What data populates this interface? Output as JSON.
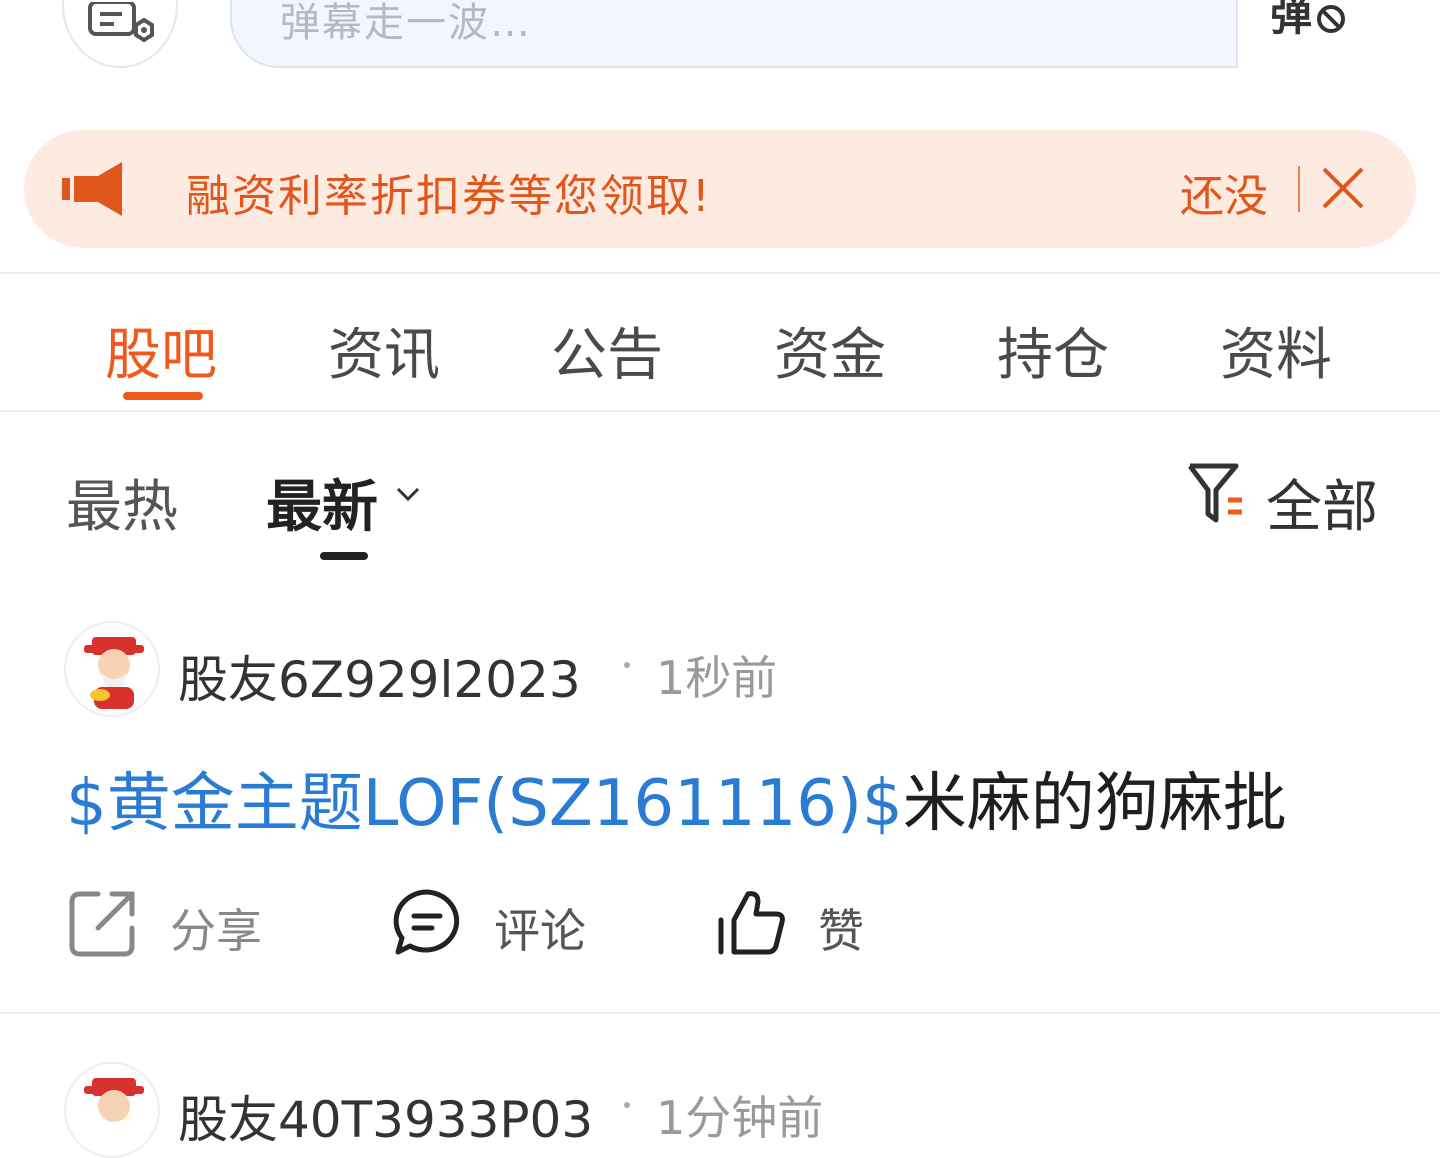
{
  "search": {
    "placeholder": "弹幕走一波…",
    "danmaku_icon": "danmaku-off-icon",
    "danmaku_char": "弹"
  },
  "banner": {
    "text": "融资利率折扣券等您领取!",
    "more": "还没",
    "icons": [
      "megaphone-icon",
      "close-icon"
    ]
  },
  "tabs": [
    {
      "label": "股吧",
      "active": true
    },
    {
      "label": "资讯"
    },
    {
      "label": "公告"
    },
    {
      "label": "资金"
    },
    {
      "label": "持仓"
    },
    {
      "label": "资料"
    }
  ],
  "sort": {
    "hot": "最热",
    "latest": "最新",
    "filter_label": "全部"
  },
  "posts": [
    {
      "username": "股友6Z929l2023",
      "time": "1秒前",
      "stock_tag": "$黄金主题LOF(SZ161116)$",
      "text": "米麻的狗麻批",
      "actions": {
        "share": "分享",
        "comment": "评论",
        "like": "赞"
      }
    },
    {
      "username": "股友40T3933P03",
      "time": "1分钟前"
    }
  ],
  "colors": {
    "accent": "#ef5a1c",
    "link": "#2a7bd3",
    "banner_bg": "#fdebe2"
  }
}
